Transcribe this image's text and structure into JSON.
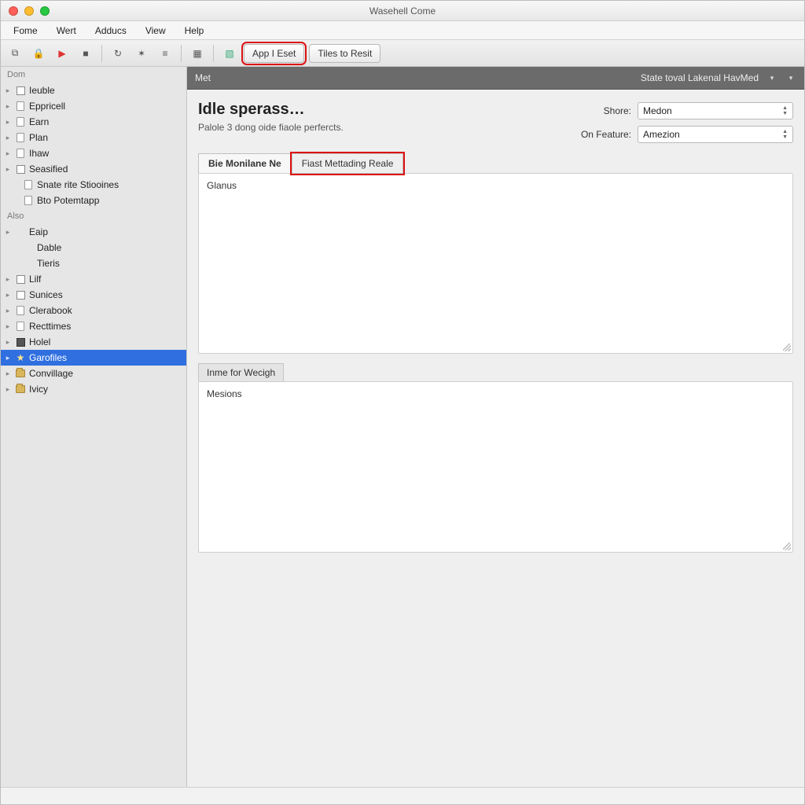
{
  "window": {
    "title": "Wasehell Come"
  },
  "menubar": [
    "Fome",
    "Wert",
    "Adducs",
    "View",
    "Help"
  ],
  "toolbar": {
    "btn_app": "App I Eset",
    "btn_tiles": "Tiles to Resit"
  },
  "sidebar": {
    "header": "Dom",
    "items": [
      {
        "label": "Ieuble",
        "icon": "box",
        "level": 1,
        "selected": false
      },
      {
        "label": "Eppricell",
        "icon": "page",
        "level": 1,
        "selected": false
      },
      {
        "label": "Earn",
        "icon": "page",
        "level": 1,
        "selected": false
      },
      {
        "label": "Plan",
        "icon": "page",
        "level": 1,
        "selected": false
      },
      {
        "label": "Ihaw",
        "icon": "page",
        "level": 1,
        "selected": false
      },
      {
        "label": "Seasified",
        "icon": "box",
        "level": 1,
        "selected": false
      },
      {
        "label": "Snate rite Stiooines",
        "icon": "page",
        "level": 1,
        "selected": false
      },
      {
        "label": "Bto Potemtapp",
        "icon": "page",
        "level": 1,
        "selected": false
      }
    ],
    "header2": "Also",
    "items2": [
      {
        "label": "Eaip",
        "icon": "none",
        "selected": false
      },
      {
        "label": "Dable",
        "icon": "none",
        "selected": false
      },
      {
        "label": "Tieris",
        "icon": "none",
        "selected": false
      },
      {
        "label": "Lilf",
        "icon": "box",
        "selected": false
      },
      {
        "label": "Sunices",
        "icon": "box",
        "selected": false
      },
      {
        "label": "Clerabook",
        "icon": "page",
        "selected": false
      },
      {
        "label": "Recttimes",
        "icon": "page",
        "selected": false
      },
      {
        "label": "Holel",
        "icon": "dark",
        "selected": false
      },
      {
        "label": "Garofiles",
        "icon": "star",
        "selected": true
      },
      {
        "label": "Convillage",
        "icon": "folder",
        "selected": false
      },
      {
        "label": "Ivicy",
        "icon": "folder",
        "selected": false
      }
    ]
  },
  "darkbar": {
    "left": "Met",
    "right": "State toval Lakenal HavMed"
  },
  "main": {
    "heading": "Idle sperass…",
    "subheading": "Palole 3 dong oide fiaole perfercts.",
    "fields": {
      "shore_label": "Shore:",
      "shore_value": "Medon",
      "feature_label": "On Feature:",
      "feature_value": "Amezion"
    },
    "tabs": {
      "tab1": "Bie Monilane Ne",
      "tab2": "Fiast Mettading Reale"
    },
    "area1_text": "Glanus",
    "block2_label": "Inme for Wecigh",
    "area2_text": "Mesions"
  }
}
